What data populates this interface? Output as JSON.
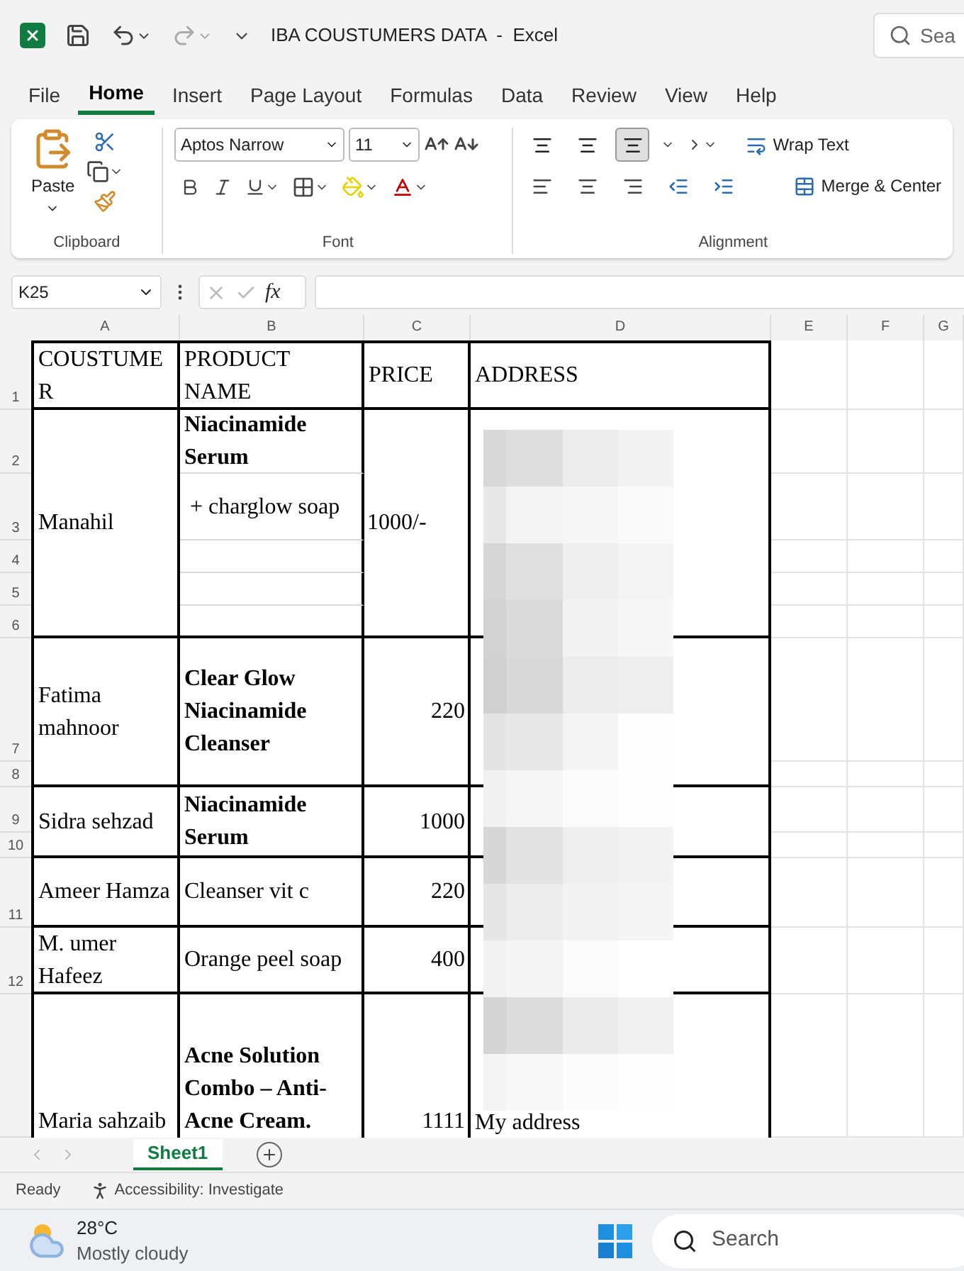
{
  "title_bar": {
    "title": "IBA COUSTUMERS DATA  -  Excel",
    "search": "Sea"
  },
  "menu_tabs": [
    {
      "label": "File",
      "selected": false
    },
    {
      "label": "Home",
      "selected": true
    },
    {
      "label": "Insert",
      "selected": false
    },
    {
      "label": "Page Layout",
      "selected": false
    },
    {
      "label": "Formulas",
      "selected": false
    },
    {
      "label": "Data",
      "selected": false
    },
    {
      "label": "Review",
      "selected": false
    },
    {
      "label": "View",
      "selected": false
    },
    {
      "label": "Help",
      "selected": false
    }
  ],
  "ribbon": {
    "clipboard": {
      "paste": "Paste",
      "group": "Clipboard"
    },
    "font": {
      "name": "Aptos Narrow",
      "size": "11",
      "group": "Font"
    },
    "alignment": {
      "vertical": [
        {
          "selected": false
        },
        {
          "selected": false
        },
        {
          "selected": true
        }
      ],
      "wrap": "Wrap Text",
      "merge": "Merge & Center",
      "group": "Alignment"
    }
  },
  "formula_bar": {
    "name_box": "K25",
    "fx": "fx"
  },
  "columns": [
    "A",
    "B",
    "C",
    "D",
    "E",
    "F",
    "G"
  ],
  "rows": [
    "1",
    "2",
    "3",
    "4",
    "5",
    "6",
    "7",
    "8",
    "9",
    "10",
    "11",
    "12"
  ],
  "header": [
    "COUSTUMER",
    "PRODUCT NAME",
    "PRICE",
    "ADDRESS"
  ],
  "records": [
    {
      "customer": "Manahil",
      "products": [
        {
          "text": "Niacinamide Serum",
          "bold": true
        },
        {
          "text": "+ charglow soap",
          "bold": false
        }
      ],
      "price": {
        "text": "1000/-",
        "kind": "text"
      }
    },
    {
      "customer": "Fatima mahnoor",
      "products": [
        {
          "text": "Clear Glow Niacinamide Cleanser",
          "bold": true
        }
      ],
      "price": {
        "text": "220",
        "kind": "number"
      }
    },
    {
      "customer": "Sidra sehzad",
      "products": [
        {
          "text": "Niacinamide Serum",
          "bold": true
        }
      ],
      "price": {
        "text": "1000",
        "kind": "number"
      }
    },
    {
      "customer": "Ameer Hamza",
      "products": [
        {
          "text": "Cleanser vit c",
          "bold": false
        }
      ],
      "price": {
        "text": "220",
        "kind": "number"
      }
    },
    {
      "customer": "M. umer Hafeez",
      "products": [
        {
          "text": "Orange peel soap",
          "bold": false
        }
      ],
      "price": {
        "text": "400",
        "kind": "number"
      }
    },
    {
      "customer": "Maria sahzaib",
      "products": [
        {
          "text": "Acne Solution Combo – Anti-Acne Cream.",
          "bold": true
        }
      ],
      "price": {
        "text": "1111",
        "kind": "number"
      },
      "address": "My address"
    }
  ],
  "sheet_tabs": [
    {
      "label": "Sheet1",
      "selected": true
    }
  ],
  "status_bar": {
    "mode": "Ready",
    "accessibility": "Accessibility: Investigate"
  },
  "taskbar": {
    "temperature": "28°C",
    "weather": "Mostly cloudy",
    "search": "Search"
  }
}
